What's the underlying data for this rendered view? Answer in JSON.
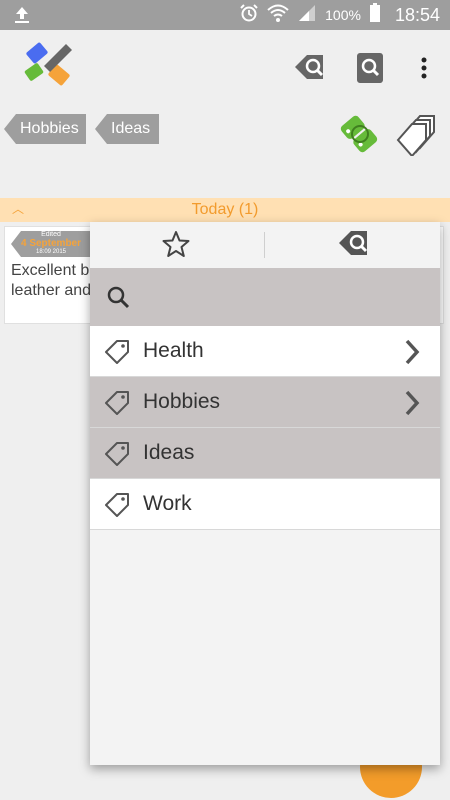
{
  "status_bar": {
    "battery": "100%",
    "time": "18:54"
  },
  "chips": [
    {
      "label": "Hobbies"
    },
    {
      "label": "Ideas"
    }
  ],
  "section": {
    "label": "Today (1)"
  },
  "note": {
    "edited": "Edited",
    "day": "4 September",
    "stamp": "18:09 2015",
    "text_line1": "Excellent b",
    "text_line2": "leather and"
  },
  "popup": {
    "search_placeholder": "",
    "tags": [
      {
        "label": "Health",
        "has_children": true,
        "selected": false
      },
      {
        "label": "Hobbies",
        "has_children": true,
        "selected": true
      },
      {
        "label": "Ideas",
        "has_children": false,
        "selected": true
      },
      {
        "label": "Work",
        "has_children": false,
        "selected": false
      }
    ]
  },
  "colors": {
    "accent": "#f29b2d",
    "selected_row": "#c8c3c3",
    "status_bar": "#9e9e9e",
    "logo_green": "#66bb3a"
  }
}
